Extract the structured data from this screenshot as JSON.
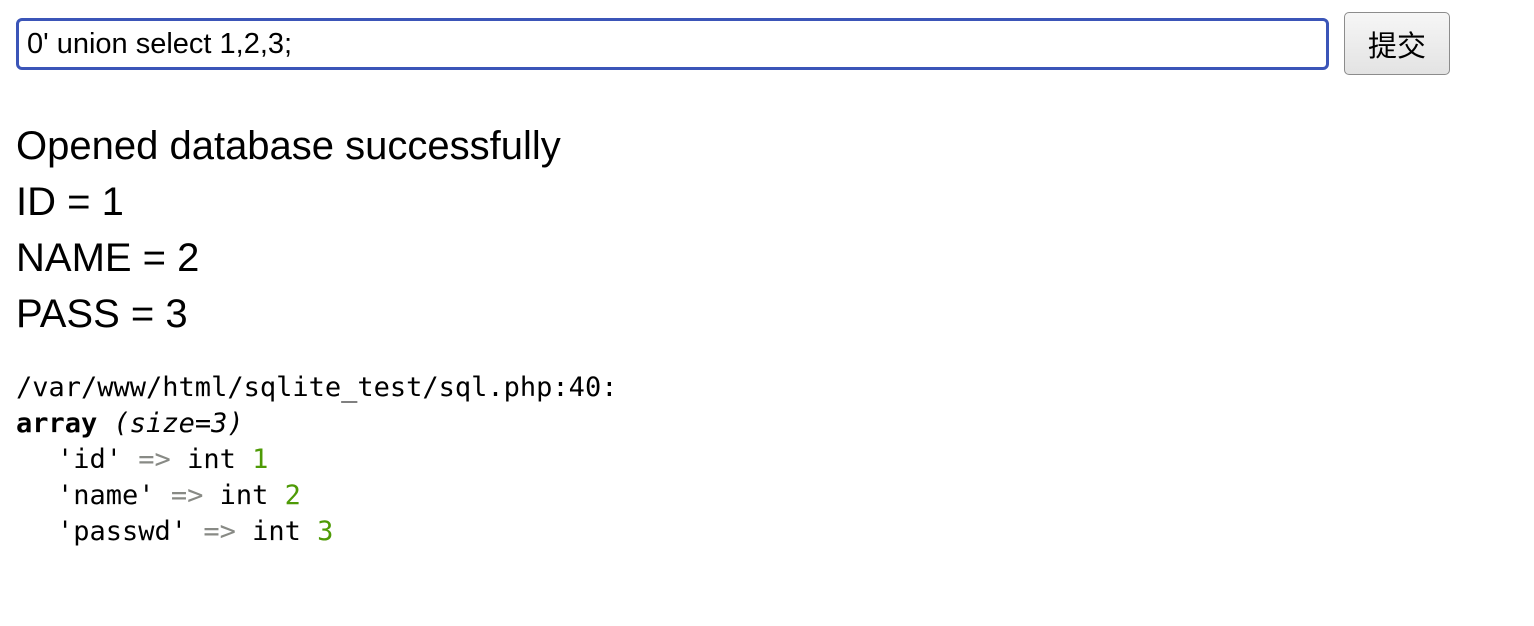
{
  "form": {
    "query_value": "0' union select 1,2,3;",
    "submit_label": "提交"
  },
  "output": {
    "lines": [
      "Opened database successfully",
      "ID = 1",
      "NAME = 2",
      "PASS = 3"
    ]
  },
  "var_dump": {
    "location": "/var/www/html/sqlite_test/sql.php:40:",
    "type_keyword": "array",
    "size_text": "(size=3)",
    "arrow": "=>",
    "entries": [
      {
        "key": "'id'",
        "type": "int",
        "value": "1"
      },
      {
        "key": "'name'",
        "type": "int",
        "value": "2"
      },
      {
        "key": "'passwd'",
        "type": "int",
        "value": "3"
      }
    ]
  },
  "colors": {
    "input_focus_border": "#3b55b8",
    "dump_arrow": "#888a85",
    "dump_number": "#4e9a06"
  }
}
